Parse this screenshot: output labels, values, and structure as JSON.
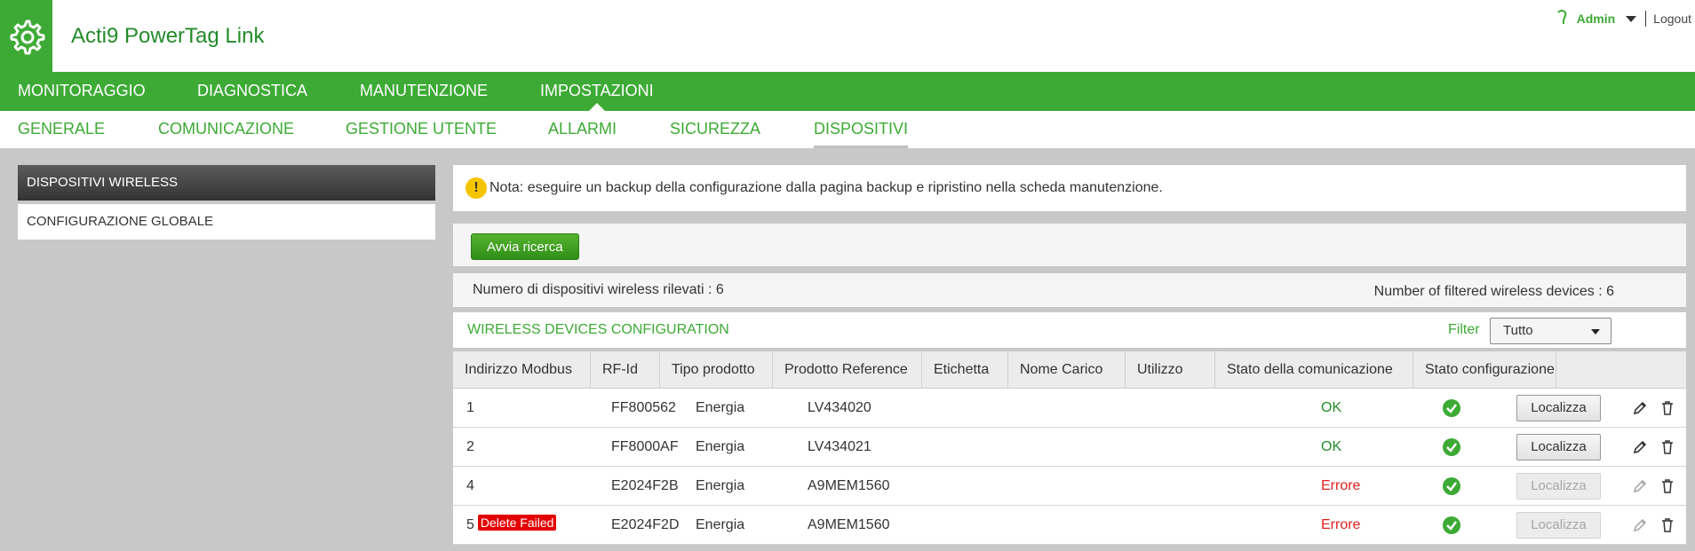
{
  "header": {
    "app_title": "Acti9 PowerTag Link",
    "logo_icon": "gear-icon",
    "user_name": "Admin",
    "logout_label": "Logout"
  },
  "main_nav": {
    "tabs": [
      {
        "label": "MONITORAGGIO"
      },
      {
        "label": "DIAGNOSTICA"
      },
      {
        "label": "MANUTENZIONE"
      },
      {
        "label": "IMPOSTAZIONI",
        "active": true
      }
    ]
  },
  "sub_nav": {
    "tabs": [
      {
        "label": "GENERALE"
      },
      {
        "label": "COMUNICAZIONE"
      },
      {
        "label": "GESTIONE UTENTE"
      },
      {
        "label": "ALLARMI"
      },
      {
        "label": "SICUREZZA"
      },
      {
        "label": "DISPOSITIVI",
        "active": true
      }
    ]
  },
  "sidebar": {
    "items": [
      {
        "label": "DISPOSITIVI WIRELESS",
        "active": true
      },
      {
        "label": "CONFIGURAZIONE GLOBALE"
      }
    ]
  },
  "note": {
    "icon_text": "!",
    "text": "Nota: eseguire un backup della configurazione dalla pagina backup e ripristino nella scheda manutenzione."
  },
  "search": {
    "button_label": "Avvia ricerca"
  },
  "counts": {
    "detected": "Numero di dispositivi wireless rilevati : 6",
    "filtered": "Number of filtered wireless devices : 6"
  },
  "config": {
    "title": "WIRELESS DEVICES CONFIGURATION",
    "filter_label": "Filter",
    "filter_value": "Tutto"
  },
  "table": {
    "columns": [
      "Indirizzo Modbus",
      "RF-Id",
      "Tipo prodotto",
      "Prodotto Reference",
      "Etichetta",
      "Nome Carico",
      "Utilizzo",
      "Stato della comunicazione",
      "Stato configurazione"
    ],
    "rows": [
      {
        "modbus": "1",
        "badge": "",
        "rfid": "FF800562",
        "type": "Energia",
        "reference": "LV434020",
        "comm_status": "OK",
        "comm_ok": true,
        "locate_label": "Localizza",
        "locate_enabled": true
      },
      {
        "modbus": "2",
        "badge": "",
        "rfid": "FF8000AF",
        "type": "Energia",
        "reference": "LV434021",
        "comm_status": "OK",
        "comm_ok": true,
        "locate_label": "Localizza",
        "locate_enabled": true
      },
      {
        "modbus": "4",
        "badge": "",
        "rfid": "E2024F2B",
        "type": "Energia",
        "reference": "A9MEM1560",
        "comm_status": "Errore",
        "comm_ok": false,
        "locate_label": "Localizza",
        "locate_enabled": false
      },
      {
        "modbus": "5",
        "badge": "Delete Failed",
        "rfid": "E2024F2D",
        "type": "Energia",
        "reference": "A9MEM1560",
        "comm_status": "Errore",
        "comm_ok": false,
        "locate_label": "Localizza",
        "locate_enabled": false
      }
    ]
  },
  "colors": {
    "brand_green": "#3daa35",
    "dark_green": "#238b2a",
    "error_red": "#e02020",
    "badge_red": "#e30000",
    "warning_yellow": "#f5c400"
  }
}
